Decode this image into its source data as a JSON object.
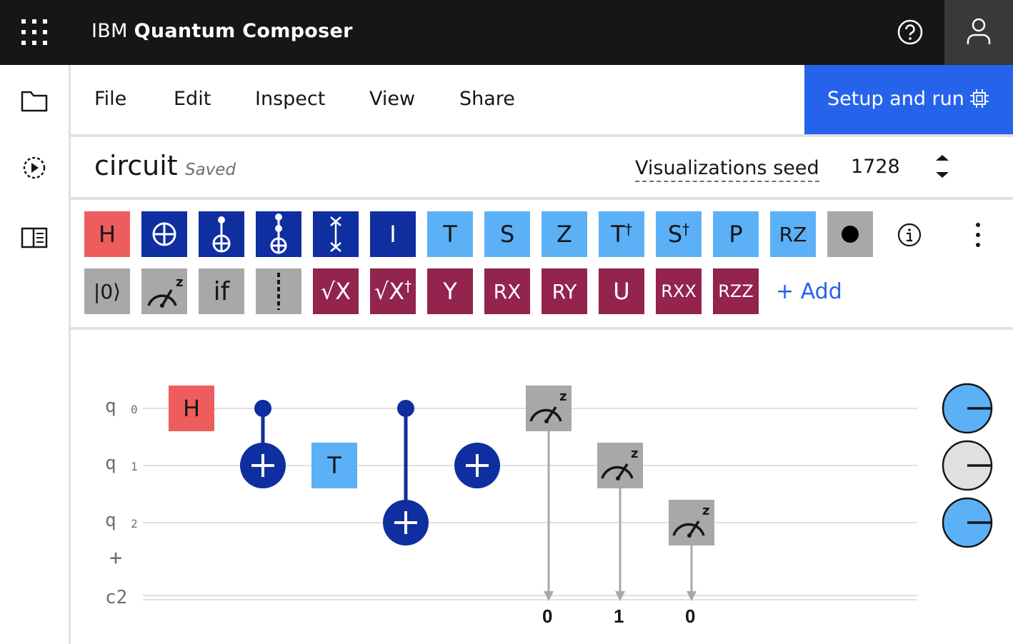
{
  "header": {
    "brand": "IBM",
    "product": "Quantum Composer",
    "icons": {
      "app_switcher": "grid-icon",
      "help": "help-icon",
      "user": "user-icon"
    },
    "colors": {
      "background": "#161616",
      "user_button": "#393939"
    }
  },
  "left_rail": {
    "items": [
      {
        "icon": "folder-icon"
      },
      {
        "icon": "replay-icon"
      },
      {
        "icon": "side-panel-icon"
      }
    ]
  },
  "menu": {
    "items": [
      {
        "label": "File"
      },
      {
        "label": "Edit"
      },
      {
        "label": "Inspect"
      },
      {
        "label": "View"
      },
      {
        "label": "Share"
      }
    ],
    "setup_button": {
      "label": "Setup and run",
      "icon": "chip-icon",
      "color": "#2563eb"
    }
  },
  "circuit_bar": {
    "name": "circuit",
    "status": "Saved",
    "seed_label": "Visualizations seed",
    "seed_value": "1728"
  },
  "palette": {
    "row1": [
      {
        "id": "h",
        "label": "H",
        "style": "red"
      },
      {
        "id": "cnot",
        "label": "",
        "icon": "cnot-icon",
        "style": "navy"
      },
      {
        "id": "cx-control",
        "label": "",
        "icon": "controlled-x-icon",
        "style": "navy"
      },
      {
        "id": "toffoli",
        "label": "",
        "icon": "toffoli-icon",
        "style": "navy"
      },
      {
        "id": "swap",
        "label": "",
        "icon": "swap-icon",
        "style": "navy"
      },
      {
        "id": "i",
        "label": "I",
        "style": "navy"
      },
      {
        "id": "t",
        "label": "T",
        "style": "lblue"
      },
      {
        "id": "s",
        "label": "S",
        "style": "lblue"
      },
      {
        "id": "z",
        "label": "Z",
        "style": "lblue"
      },
      {
        "id": "tdg",
        "label": "T",
        "sup": "†",
        "style": "lblue"
      },
      {
        "id": "sdg",
        "label": "S",
        "sup": "†",
        "style": "lblue"
      },
      {
        "id": "p",
        "label": "P",
        "style": "lblue"
      },
      {
        "id": "rz",
        "label": "RZ",
        "style": "lblue"
      },
      {
        "id": "control",
        "label": "",
        "icon": "control-dot-icon",
        "style": "gray"
      }
    ],
    "row2": [
      {
        "id": "reset",
        "label": "|0⟩",
        "style": "gray"
      },
      {
        "id": "measure",
        "label": "",
        "icon": "measure-icon",
        "style": "gray"
      },
      {
        "id": "if",
        "label": "if",
        "style": "gray"
      },
      {
        "id": "barrier",
        "label": "",
        "icon": "barrier-icon",
        "style": "gray"
      },
      {
        "id": "sx",
        "label": "√X",
        "style": "wine"
      },
      {
        "id": "sxdg",
        "label": "√X",
        "sup": "†",
        "style": "wine"
      },
      {
        "id": "y",
        "label": "Y",
        "style": "wine"
      },
      {
        "id": "rx",
        "label": "RX",
        "style": "wine"
      },
      {
        "id": "ry",
        "label": "RY",
        "style": "wine"
      },
      {
        "id": "u",
        "label": "U",
        "style": "wine"
      },
      {
        "id": "rxx",
        "label": "RXX",
        "style": "wine"
      },
      {
        "id": "rzz",
        "label": "RZZ",
        "style": "wine"
      }
    ],
    "add_label": "+ Add",
    "colors": {
      "red": "#ee5d5d",
      "navy": "#0f2e9f",
      "lblue": "#5cb0f6",
      "gray": "#a8a8a8",
      "wine": "#92244e"
    }
  },
  "circuit": {
    "qubits": [
      {
        "label": "q",
        "index": "0"
      },
      {
        "label": "q",
        "index": "1"
      },
      {
        "label": "q",
        "index": "2"
      }
    ],
    "add_qubit": "+",
    "classical_register": "c2",
    "gates": [
      {
        "type": "H",
        "qubit": 0,
        "column": 0
      },
      {
        "type": "CNOT",
        "control": 0,
        "target": 1,
        "column": 1
      },
      {
        "type": "T",
        "qubit": 1,
        "column": 2
      },
      {
        "type": "CNOT",
        "control": 0,
        "target": 2,
        "column": 3
      },
      {
        "type": "X",
        "qubit": 1,
        "column": 4
      },
      {
        "type": "Measure",
        "qubit": 0,
        "column": 5,
        "cbit": "0"
      },
      {
        "type": "Measure",
        "qubit": 1,
        "column": 6,
        "cbit": "1"
      },
      {
        "type": "Measure",
        "qubit": 2,
        "column": 7,
        "cbit": "0"
      }
    ],
    "phase_disks": [
      {
        "qubit": 0,
        "color": "#5cb0f6"
      },
      {
        "qubit": 1,
        "color": "#e0e0e0"
      },
      {
        "qubit": 2,
        "color": "#5cb0f6"
      }
    ]
  }
}
